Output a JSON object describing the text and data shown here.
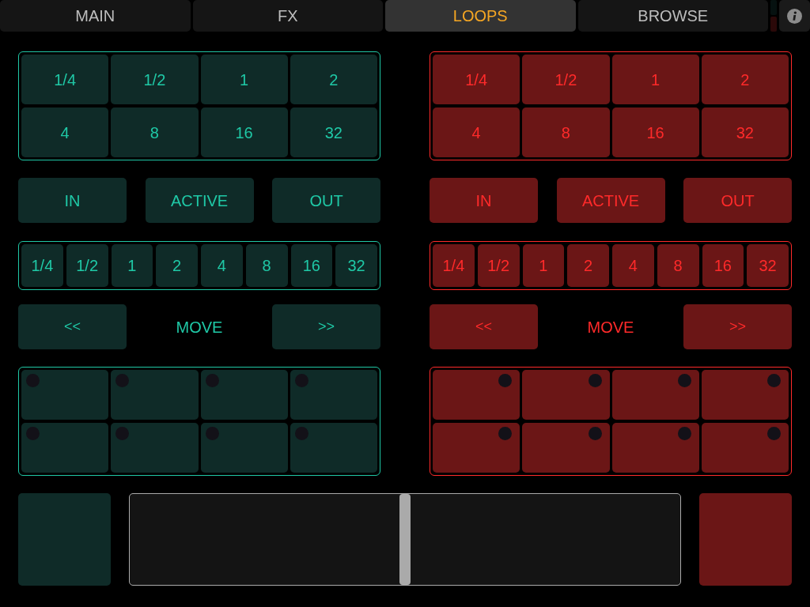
{
  "tabs": [
    {
      "label": "MAIN",
      "selected": false
    },
    {
      "label": "FX",
      "selected": false
    },
    {
      "label": "LOOPS",
      "selected": true
    },
    {
      "label": "BROWSE",
      "selected": false
    }
  ],
  "decks": [
    {
      "color": "#1fc8a6",
      "fill": {
        "color": "#0f2b28"
      },
      "loop_lengths": [
        "1/4",
        "1/2",
        "1",
        "2",
        "4",
        "8",
        "16",
        "32"
      ],
      "loop_controls": [
        "IN",
        "ACTIVE",
        "OUT"
      ],
      "move_lengths": [
        "1/4",
        "1/2",
        "1",
        "2",
        "4",
        "8",
        "16",
        "32"
      ],
      "move": {
        "back": "<<",
        "label": "MOVE",
        "forward": ">>"
      },
      "dots_right": false,
      "pads": [
        {
          "lit": false
        },
        {
          "lit": false
        },
        {
          "lit": false
        },
        {
          "lit": false
        },
        {
          "lit": false
        },
        {
          "lit": false
        },
        {
          "lit": false
        },
        {
          "lit": false
        }
      ]
    },
    {
      "color": "#ff2a2a",
      "fill": {
        "color": "#6b1616"
      },
      "loop_lengths": [
        "1/4",
        "1/2",
        "1",
        "2",
        "4",
        "8",
        "16",
        "32"
      ],
      "loop_controls": [
        "IN",
        "ACTIVE",
        "OUT"
      ],
      "move_lengths": [
        "1/4",
        "1/2",
        "1",
        "2",
        "4",
        "8",
        "16",
        "32"
      ],
      "move": {
        "back": "<<",
        "label": "MOVE",
        "forward": ">>"
      },
      "dots_right": true,
      "pads": [
        {
          "lit": false
        },
        {
          "lit": false
        },
        {
          "lit": false
        },
        {
          "lit": false
        },
        {
          "lit": false
        },
        {
          "lit": false
        },
        {
          "lit": false
        },
        {
          "lit": false
        }
      ]
    }
  ],
  "crossfader": {
    "level": 0.5
  }
}
